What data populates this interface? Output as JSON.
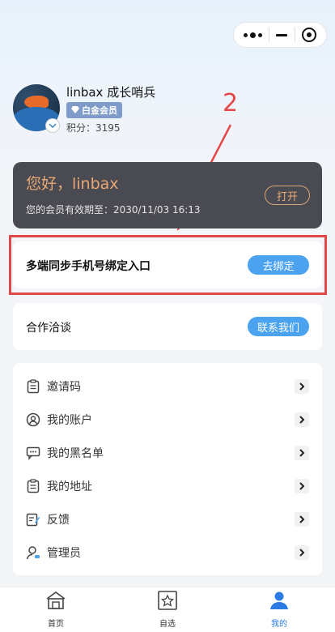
{
  "profile": {
    "username": "linbax 成长哨兵",
    "vip_tag": "白金会员",
    "points": "积分：3195"
  },
  "annotation": {
    "number": "2",
    "color": "#e54848"
  },
  "vip_card": {
    "greeting": "您好，linbax",
    "expiry": "您的会员有效期至：2030/11/03 16:13",
    "open_button": "打开"
  },
  "bind_card": {
    "label": "多端同步手机号绑定入口",
    "button": "去绑定"
  },
  "coop_card": {
    "label": "合作洽谈",
    "button": "联系我们"
  },
  "menu": {
    "items": [
      {
        "label": "邀请码",
        "icon": "clipboard-icon"
      },
      {
        "label": "我的账户",
        "icon": "user-circle-icon"
      },
      {
        "label": "我的黑名单",
        "icon": "chat-icon"
      },
      {
        "label": "我的地址",
        "icon": "clipboard-icon"
      },
      {
        "label": "反馈",
        "icon": "edit-icon"
      },
      {
        "label": "管理员",
        "icon": "admin-icon"
      }
    ]
  },
  "tabbar": {
    "tabs": [
      {
        "label": "首页",
        "icon": "home-icon"
      },
      {
        "label": "自选",
        "icon": "star-icon"
      },
      {
        "label": "我的",
        "icon": "person-icon"
      }
    ],
    "active_index": 2
  },
  "colors": {
    "accent": "#4ba3f0",
    "card_dark": "#4a4a52",
    "vip_gold": "#e8a873",
    "active_tab": "#2c7be5"
  }
}
